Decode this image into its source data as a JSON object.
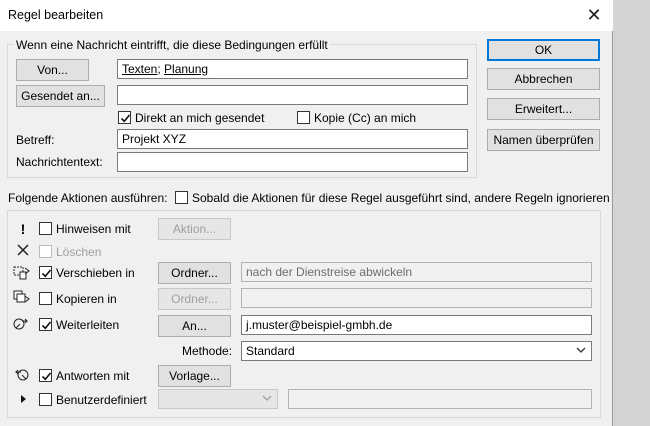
{
  "window": {
    "title": "Regel bearbeiten",
    "close_glyph": "✕"
  },
  "conditions": {
    "group_label": "Wenn eine Nachricht eintrifft, die diese Bedingungen erfüllt",
    "from_button": "Von...",
    "from_value_1": "Texten",
    "from_separator": "; ",
    "from_value_2": "Planung",
    "sent_to_button": "Gesendet an...",
    "sent_to_value": "",
    "direct_to_me_label": "Direkt an mich gesendet",
    "direct_to_me_checked": true,
    "cc_to_me_label": "Kopie (Cc) an mich",
    "cc_to_me_checked": false,
    "subject_label": "Betreff:",
    "subject_value": "Projekt XYZ",
    "body_label": "Nachrichtentext:",
    "body_value": ""
  },
  "side_buttons": {
    "ok": "OK",
    "cancel": "Abbrechen",
    "advanced": "Erweitert...",
    "check_names": "Namen überprüfen"
  },
  "actions": {
    "group_label": "Folgende Aktionen ausführen:",
    "stop_processing_label": "Sobald die Aktionen für diese Regel ausgeführt sind, andere Regeln ignorieren",
    "stop_processing_checked": false,
    "alert_label": "Hinweisen mit",
    "alert_checked": false,
    "alert_button": "Aktion...",
    "delete_label": "Löschen",
    "delete_checked": false,
    "move_label": "Verschieben in",
    "move_checked": true,
    "move_button": "Ordner...",
    "move_value": "nach der Dienstreise abwickeln",
    "copy_label": "Kopieren in",
    "copy_checked": false,
    "copy_button": "Ordner...",
    "copy_value": "",
    "forward_label": "Weiterleiten",
    "forward_checked": true,
    "forward_button": "An...",
    "forward_value": "j.muster@beispiel-gmbh.de",
    "method_label": "Methode:",
    "method_value": "Standard",
    "reply_label": "Antworten mit",
    "reply_checked": true,
    "reply_button": "Vorlage...",
    "custom_label": "Benutzerdefiniert",
    "custom_checked": false,
    "custom_select_value": "",
    "custom_value": ""
  },
  "icons": {
    "alert": "exclamation-icon",
    "delete": "x-icon",
    "move": "move-to-folder-icon",
    "copy": "copy-to-folder-icon",
    "forward": "forward-icon",
    "reply": "reply-icon",
    "custom": "expand-triangle-icon"
  }
}
